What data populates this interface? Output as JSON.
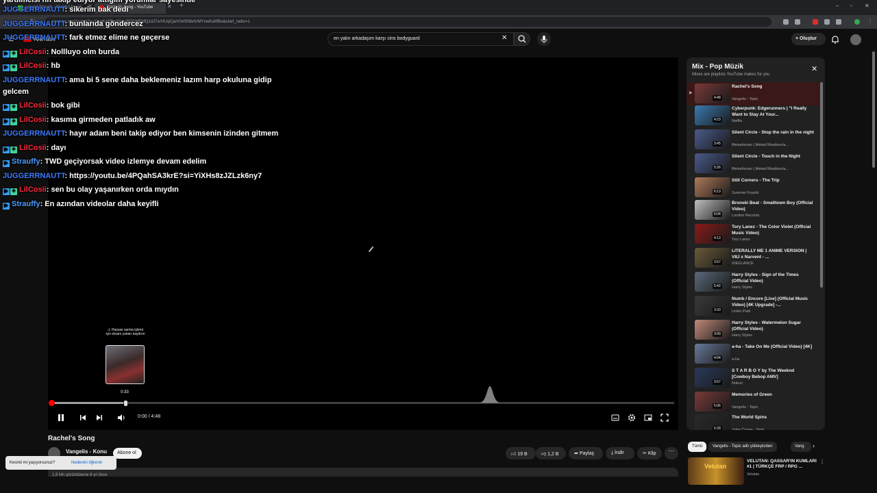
{
  "browser": {
    "tabs": [
      {
        "label": "wicard Stream - Watch Live on",
        "color": "#53fc18"
      },
      {
        "label": "Rachel's Song - YouTube",
        "color": "#ff0000"
      }
    ],
    "new_tab": "+",
    "url": "youtube.com/watch?v=YnwKaiIfBw&list=RDGMEMQ1dJ7wXfLlqCjwV0xfSNbAVMYnwKaiIfBw&start_radio=1"
  },
  "yt_header": {
    "logo_text": "YouTube",
    "logo_sup": "TR",
    "search_value": "en yalın arkadaşım karşı cins bodyguard",
    "search_clear": "✕",
    "create_label": "Oluştur"
  },
  "chat": [
    {
      "badges": [],
      "user": "",
      "text": "yardımcısı nn takip ediyor attığım yorumlar sayesinde",
      "user_class": "u-blue"
    },
    {
      "badges": [],
      "user": "JUGGERRNAUTT",
      "text": ": sikerim bak dedi",
      "user_class": "u-blue"
    },
    {
      "badges": [],
      "user": "JUGGERRNAUTT",
      "text": ": bunlarıda göndercez",
      "user_class": "u-blue"
    },
    {
      "badges": [],
      "user": "JUGGERRNAUTT",
      "text": ": fark etmez elime ne geçerse",
      "user_class": "u-blue"
    },
    {
      "badges": [
        "b-blue",
        "b-green"
      ],
      "user": "LilCosii",
      "text": ": Nollluyo olm burda",
      "user_class": "u-red"
    },
    {
      "badges": [
        "b-blue",
        "b-green"
      ],
      "user": "LilCosii",
      "text": ": hb",
      "user_class": "u-red"
    },
    {
      "badges": [],
      "user": "JUGGERRNAUTT",
      "text": ": ama bi 5 sene daha beklemeniz lazım harp okuluna gidip",
      "user_class": "u-blue"
    },
    {
      "badges": [],
      "user": "",
      "text": "gelcem",
      "user_class": "u-blue"
    },
    {
      "badges": [
        "b-blue",
        "b-green"
      ],
      "user": "LilCosii",
      "text": ": bok gibi",
      "user_class": "u-red"
    },
    {
      "badges": [
        "b-blue",
        "b-green"
      ],
      "user": "LilCosii",
      "text": ": kasıma girmeden patladık aw",
      "user_class": "u-red"
    },
    {
      "badges": [],
      "user": "JUGGERRNAUTT",
      "text": ": hayır adam beni takip ediyor ben kimsenin izinden gitmem",
      "user_class": "u-blue"
    },
    {
      "badges": [
        "b-blue",
        "b-green"
      ],
      "user": "LilCosii",
      "text": ": dayı",
      "user_class": "u-red"
    },
    {
      "badges": [
        "b-blue"
      ],
      "user": "Strauffy",
      "text": ": TWD geçiyorsak video izlemye devam edelim",
      "user_class": "u-teal"
    },
    {
      "badges": [],
      "user": "JUGGERRNAUTT",
      "text": ": https://youtu.be/4PQahSA3krE?si=YiXHs8zJZLzk6ny7",
      "user_class": "u-blue"
    },
    {
      "badges": [
        "b-blue",
        "b-green"
      ],
      "user": "LilCosii",
      "text": ": sen bu olay yaşanırken orda mıydın",
      "user_class": "u-red"
    },
    {
      "badges": [
        "b-blue"
      ],
      "user": "Strauffy",
      "text": ": En azından videolar daha keyifli",
      "user_class": "u-teal"
    }
  ],
  "player": {
    "tooltip": "⚠ Hassas sarma işlemi için ekranı yukarı kaydırın",
    "hover_time": "0:33",
    "time_display": "0:00 / 4:48",
    "progress_played": 0.0,
    "progress_hover": 0.1146
  },
  "video": {
    "title": "Rachel's Song",
    "channel": "Vangelis - Konu",
    "subscribe": "Abone ol",
    "like": "19 B",
    "dislike": "1,2 B",
    "share": "Paylaş",
    "download": "İndir",
    "clip": "Klip",
    "more": "⋯",
    "views": "1,9 Mn görüntüleme  8 yıl önce"
  },
  "toast": {
    "text": "Kesinti mi yaşıyorsunuz?",
    "link": "Nedenini öğrenin"
  },
  "playlist": {
    "title": "Mix - Pop Müzik",
    "subtitle": "Mixes are playlists YouTube makes for you",
    "close": "✕",
    "items": [
      {
        "idx": "▶",
        "title": "Rachel's Song",
        "channel": "Vangelis - Topic",
        "duration": "4:48",
        "thumb": "#7a3a3a",
        "current": true
      },
      {
        "idx": "",
        "title": "Cyberpunk: Edgerunners | \"I Really Want to Stay At Your...",
        "channel": "Netflix",
        "duration": "4:23",
        "thumb": "#3a7ab0"
      },
      {
        "idx": "",
        "title": "Silent Circle - Stop the rain in the night",
        "channel": "Meiselmusic | Meisel Musikverla...",
        "duration": "3:45",
        "thumb": "#4a5a8a"
      },
      {
        "idx": "",
        "title": "Silent Circle - Touch in the Night",
        "channel": "Meiselmusic | Meisel Musikverla...",
        "duration": "5:26",
        "thumb": "#4a5a8a"
      },
      {
        "idx": "",
        "title": "Still Corners - The Trip",
        "channel": "Summer Fossils",
        "duration": "6:13",
        "thumb": "#b07a5a"
      },
      {
        "idx": "",
        "title": "Bronski Beat - Smalltown Boy (Official Video)",
        "channel": "London Records",
        "duration": "5:04",
        "thumb": "#c0c0c0"
      },
      {
        "idx": "",
        "title": "Tory Lanez - The Color Violet (Official Music Video)",
        "channel": "Tory Lanez",
        "duration": "4:13",
        "thumb": "#8a1a1a"
      },
      {
        "idx": "",
        "title": "LITERALLY ME 1 ANIME VERSION | V8J x Narvent - ...",
        "channel": "IDEGLANCE",
        "duration": "3:57",
        "thumb": "#6a5a3a"
      },
      {
        "idx": "",
        "title": "Harry Styles - Sign of the Times (Official Video)",
        "channel": "Harry Styles",
        "duration": "5:42",
        "thumb": "#5a6a7a"
      },
      {
        "idx": "",
        "title": "Numb / Encore [Live] (Official Music Video) [4K Upgrade] -...",
        "channel": "Linkin Park",
        "duration": "3:33",
        "thumb": "#3a3a3a"
      },
      {
        "idx": "",
        "title": "Harry Styles - Watermelon Sugar (Official Video)",
        "channel": "Harry Styles",
        "duration": "3:09",
        "thumb": "#c08a7a"
      },
      {
        "idx": "",
        "title": "a-ha - Take On Me (Official Video) [4K]",
        "channel": "a-ha",
        "duration": "4:04",
        "thumb": "#6a7a9a"
      },
      {
        "idx": "",
        "title": "S T A R B O Y by The Weeknd [Cowboy Bebop AMV]",
        "channel": "Nokuri",
        "duration": "3:57",
        "thumb": "#2a3a5a"
      },
      {
        "idx": "",
        "title": "Memories of Green",
        "channel": "Vangelis - Topic",
        "duration": "5:06",
        "thumb": "#7a3a3a"
      },
      {
        "idx": "",
        "title": "The World Spins",
        "channel": "Julee Cruise - Topic",
        "duration": "6:39",
        "thumb": "#2a2a2a"
      }
    ]
  },
  "chips": [
    {
      "label": "Tümü",
      "active": true
    },
    {
      "label": "Vangelis - Topic adlı yükleyiciden",
      "active": false
    },
    {
      "label": "Vang",
      "active": false
    }
  ],
  "recommended": {
    "title": "VELUTAN: QASSAR'IN KUMLARI #1 | TÜRKÇE FRP / RPG ...",
    "channel": "Velutan",
    "thumb_text": "Velutan"
  }
}
